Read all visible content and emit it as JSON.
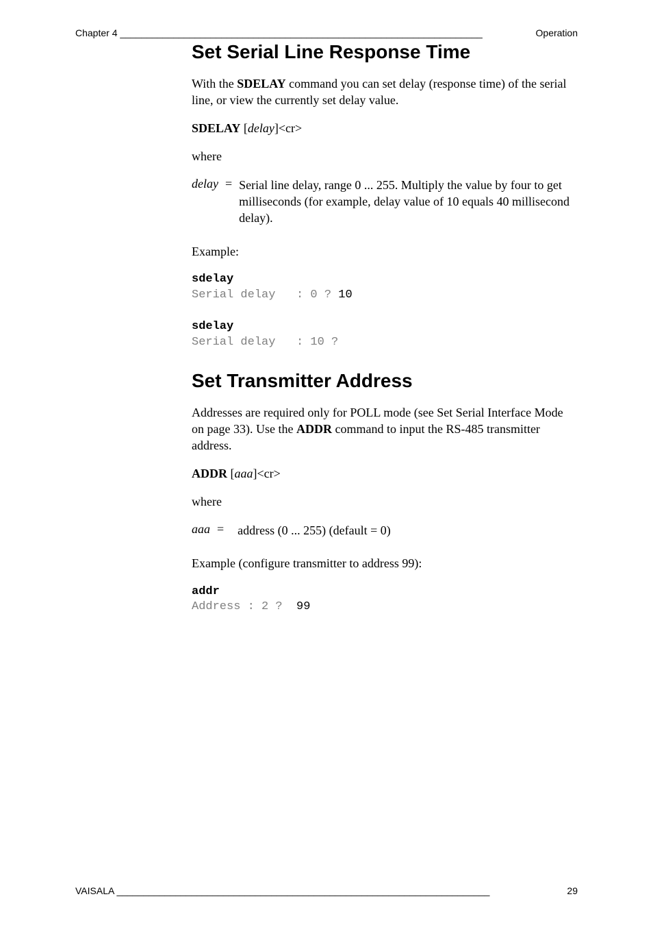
{
  "header": {
    "left": "Chapter 4 ____________________________________________________________________",
    "right": "Operation"
  },
  "section1": {
    "title": "Set Serial Line Response Time",
    "intro_pre": "With the ",
    "intro_cmd": "SDELAY",
    "intro_post": " command you can set delay (response time) of the serial line, or view the currently set delay value.",
    "syntax_cmd": "SDELAY",
    "syntax_arg_open": " [",
    "syntax_arg": "delay",
    "syntax_arg_close": "]<cr>",
    "where_label": "where",
    "def_term": "delay",
    "def_sep": "=",
    "def_text": "Serial line delay, range 0 ... 255. Multiply the value by four to get milliseconds (for example, delay value of 10 equals 40 millisecond delay).",
    "example_label": "Example:",
    "code_b1": "sdelay",
    "code_g1": "Serial delay   : 0 ?",
    "code_in1": " 10",
    "code_b2": "sdelay",
    "code_g2": "Serial delay   : 10 ?"
  },
  "section2": {
    "title": "Set Transmitter Address",
    "intro_pre": "Addresses are required only for POLL mode (see Set Serial Interface Mode on page 33). Use the ",
    "intro_cmd": "ADDR",
    "intro_post": " command to input the RS-485 transmitter address.",
    "syntax_cmd": "ADDR",
    "syntax_arg_open": " [",
    "syntax_arg": "aaa",
    "syntax_arg_close": "]<cr>",
    "where_label": "where",
    "def_term": "aaa",
    "def_sep": " =",
    "def_text": "address (0 ... 255) (default = 0)",
    "example_label": "Example (configure transmitter to address 99):",
    "code_b1": "addr",
    "code_g1": "Address : 2 ? ",
    "code_in1": " 99"
  },
  "footer": {
    "left": "VAISALA ______________________________________________________________________",
    "right": "29"
  }
}
